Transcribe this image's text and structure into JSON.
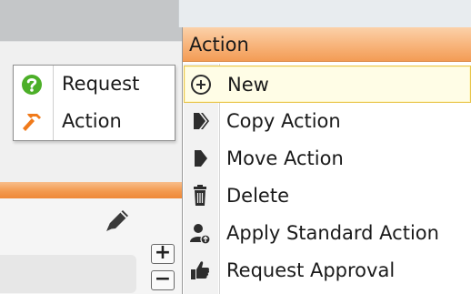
{
  "legend": {
    "items": [
      {
        "label": "Request",
        "icon": "question-circle-icon",
        "color": "#4caf28"
      },
      {
        "label": "Action",
        "icon": "hammer-icon",
        "color": "#f07a1a"
      }
    ]
  },
  "stepper": {
    "plus": "+",
    "minus": "−"
  },
  "menu": {
    "title": "Action",
    "items": [
      {
        "label": "New",
        "icon": "plus-circle-icon",
        "highlighted": true
      },
      {
        "label": "Copy Action",
        "icon": "double-arrow-icon"
      },
      {
        "label": "Move Action",
        "icon": "arrow-right-icon"
      },
      {
        "label": "Delete",
        "icon": "trash-icon"
      },
      {
        "label": "Apply Standard Action",
        "icon": "user-upload-icon"
      },
      {
        "label": "Request Approval",
        "icon": "thumbs-up-icon"
      }
    ]
  },
  "colors": {
    "accent_orange": "#f39c55",
    "highlight_border": "#e8c44a",
    "icon_dark": "#2d2d2d"
  }
}
